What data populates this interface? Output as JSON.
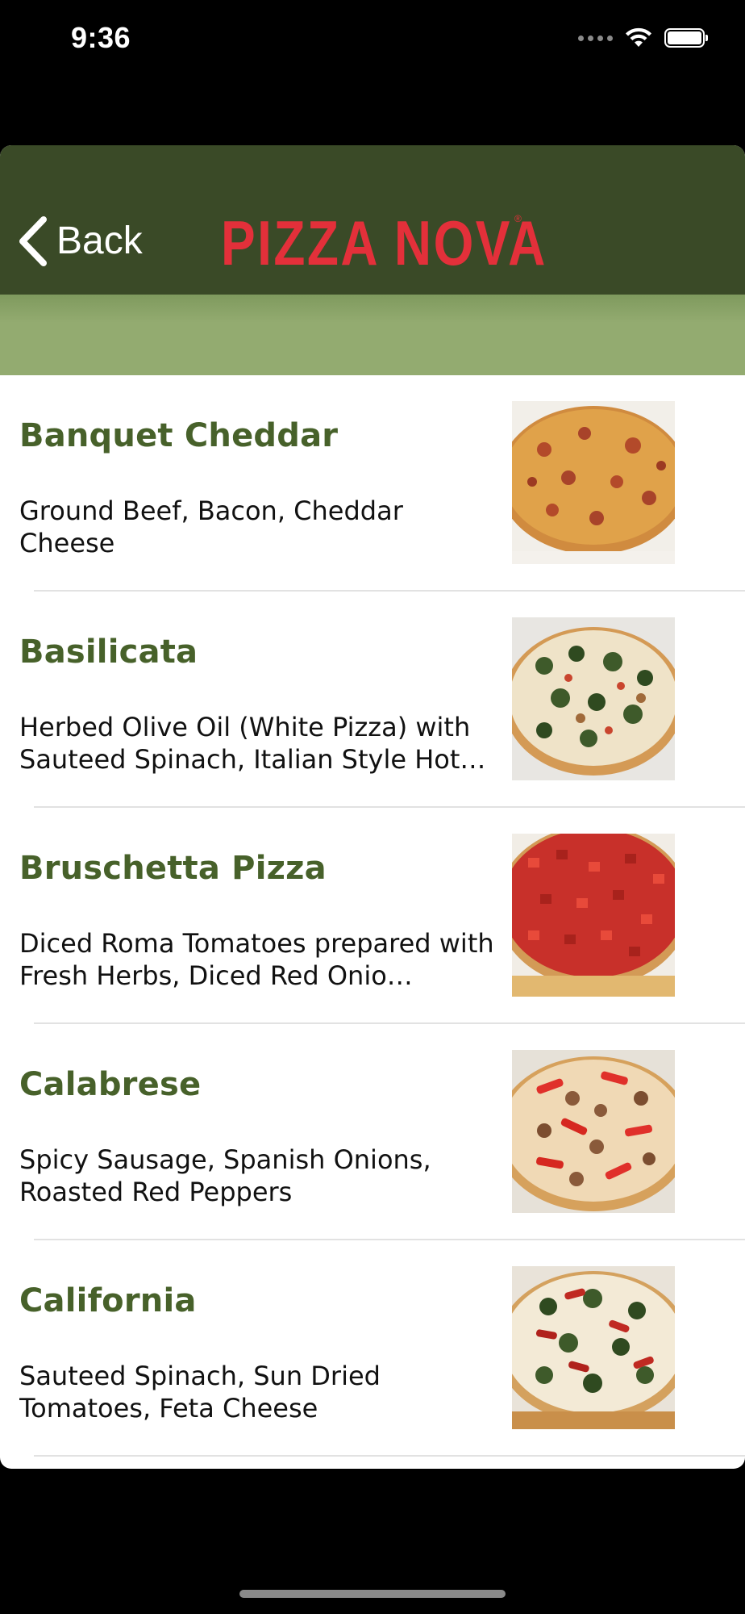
{
  "status_bar": {
    "time": "9:36"
  },
  "nav": {
    "back_label": "Back",
    "logo_text": "PIZZA NOVA",
    "logo_reg": "®",
    "colors": {
      "nav_background": "#3a4a27",
      "sub_header": "#93ab70",
      "logo_red": "#e3303a",
      "title_green": "#47612a"
    }
  },
  "menu": {
    "items": [
      {
        "title": "Banquet Cheddar",
        "description": "Ground Beef, Bacon, Cheddar Cheese",
        "image": "pizza-photo"
      },
      {
        "title": "Basilicata",
        "description": "Herbed Olive Oil (White Pizza) with Sauteed Spinach, Italian Style Hot…",
        "image": "pizza-photo"
      },
      {
        "title": "Bruschetta Pizza",
        "description": "Diced Roma Tomatoes prepared with Fresh Herbs, Diced Red Onio…",
        "image": "pizza-photo"
      },
      {
        "title": "Calabrese",
        "description": "Spicy Sausage, Spanish Onions, Roasted Red Peppers",
        "image": "pizza-photo"
      },
      {
        "title": "California",
        "description": "Sauteed Spinach, Sun Dried Tomatoes, Feta Cheese",
        "image": "pizza-photo"
      }
    ]
  }
}
